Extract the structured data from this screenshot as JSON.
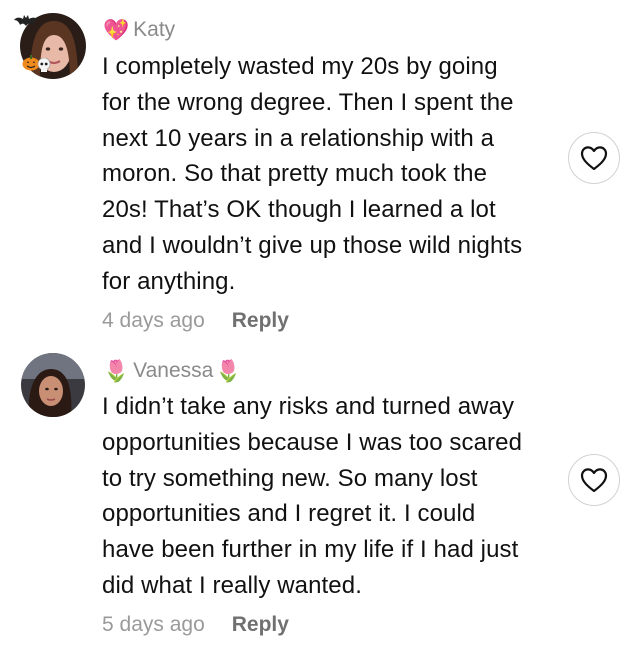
{
  "comments": [
    {
      "name": "Katy",
      "name_emoji_before": "💖",
      "name_emoji_after": "",
      "avatar_icon": "user-avatar-photo",
      "text": "I completely wasted my 20s by going\nfor the wrong degree. Then I spent the\nnext 10 years in a relationship with a\nmoron. So that pretty much took the\n20s! That’s OK though I learned a lot\nand I wouldn’t give up those wild nights\nfor anything.",
      "time": "4 days ago",
      "reply_label": "Reply",
      "like_icon": "heart-outline-icon"
    },
    {
      "name": "Vanessa",
      "name_emoji_before": "🌷",
      "name_emoji_after": "🌷",
      "avatar_icon": "user-avatar-photo",
      "text": "I didn’t take any risks and turned away\nopportunities because I was too scared\nto try something new. So many lost\nopportunities and I regret it. I could\nhave been further in my life if I had just\ndid what I really wanted.",
      "time": "5 days ago",
      "reply_label": "Reply",
      "like_icon": "heart-outline-icon"
    }
  ],
  "colors": {
    "background": "#ffffff",
    "text": "#111111",
    "name": "#8a8a8a",
    "timestamp": "#9a9a9a",
    "reply": "#707070",
    "like_border": "#d2d2d2"
  }
}
